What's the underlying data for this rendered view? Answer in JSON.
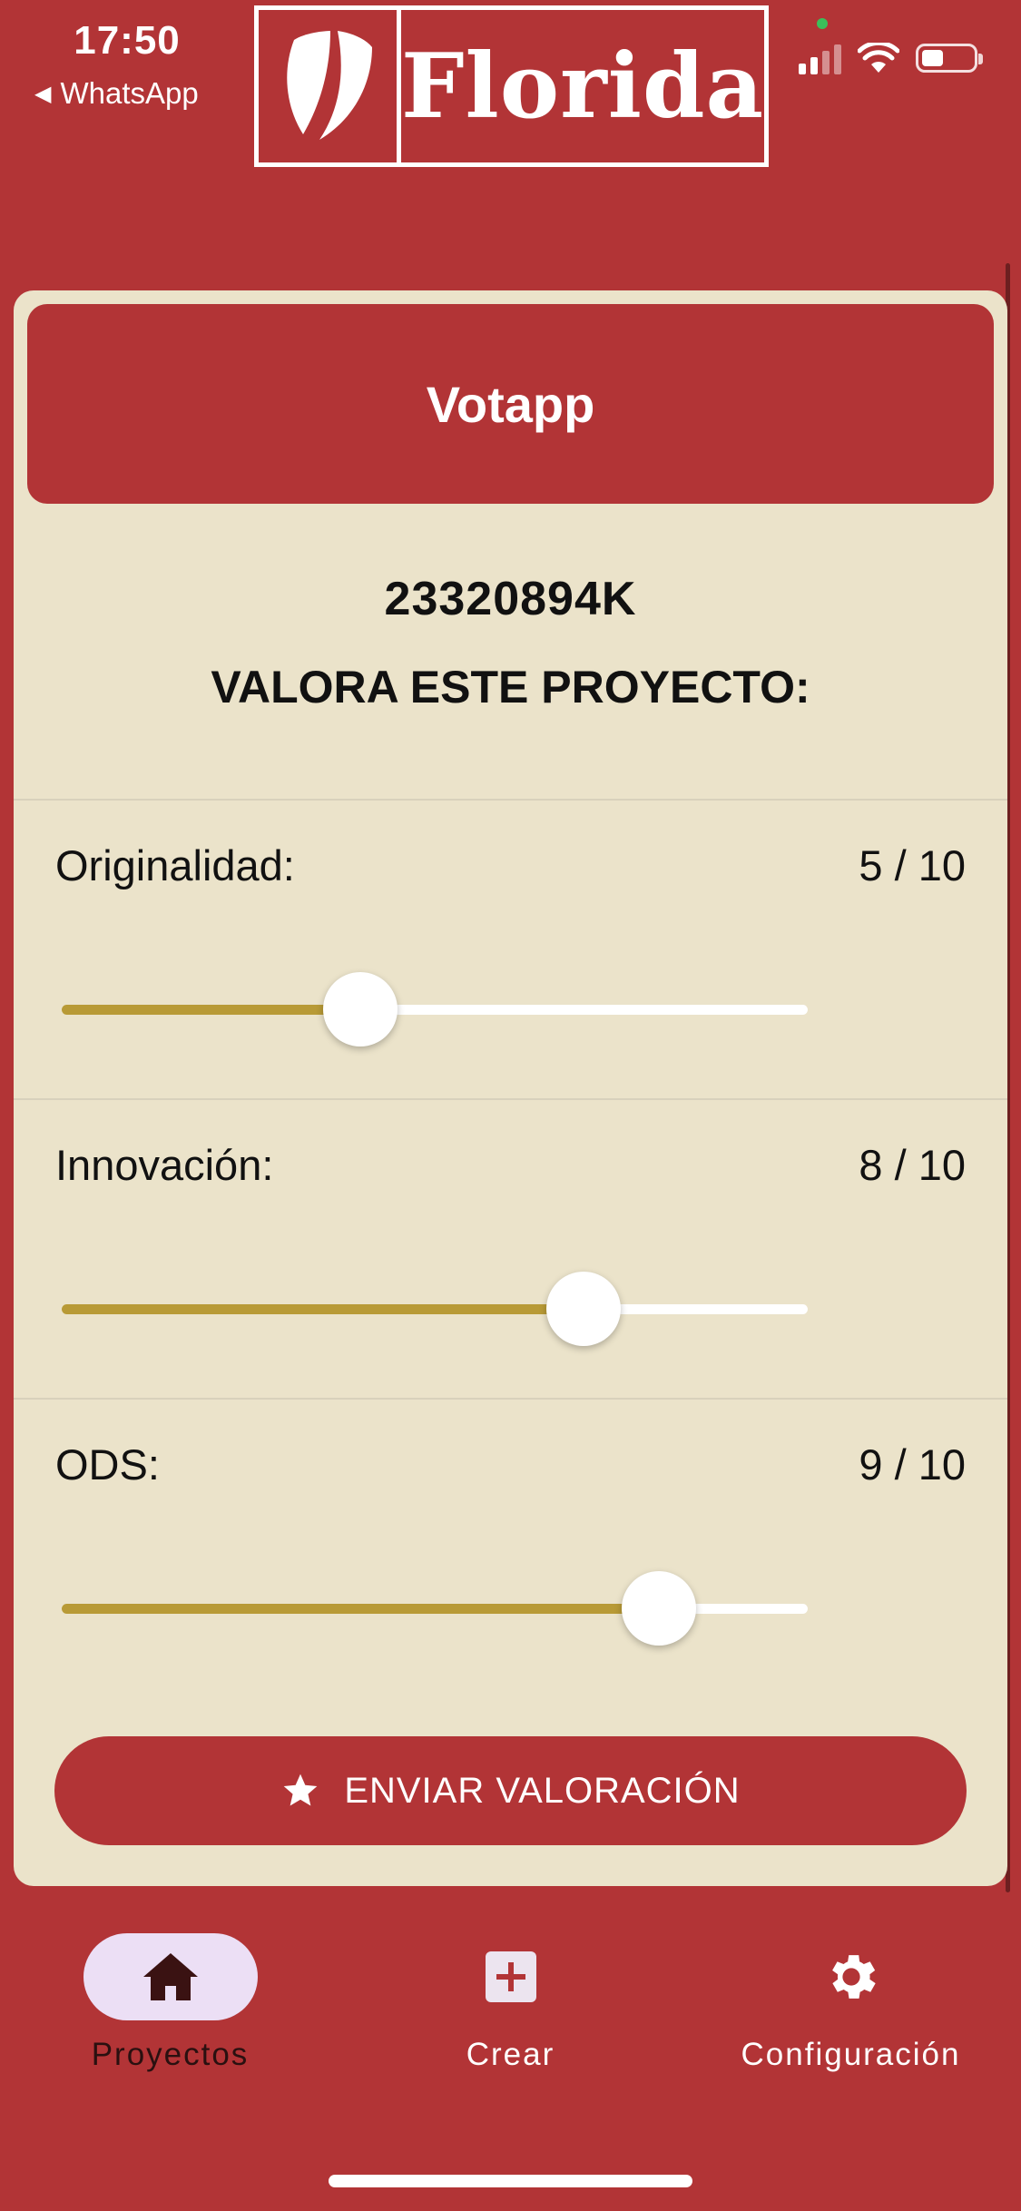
{
  "status_bar": {
    "time": "17:50",
    "back_app": "WhatsApp",
    "icons": [
      "signal-icon",
      "wifi-icon",
      "battery-icon"
    ]
  },
  "logo": {
    "text": "Florida",
    "icon": "shield-leaf-icon"
  },
  "header": {
    "title": "Votapp"
  },
  "project": {
    "id": "23320894K",
    "prompt": "VALORA ESTE PROYECTO:"
  },
  "criteria": [
    {
      "label": "Originalidad:",
      "score_text": "5 / 10",
      "value": 5,
      "max": 10
    },
    {
      "label": "Innovación:",
      "score_text": "8 / 10",
      "value": 8,
      "max": 10
    },
    {
      "label": "ODS:",
      "score_text": "9 / 10",
      "value": 9,
      "max": 10
    }
  ],
  "submit": {
    "label": "ENVIAR VALORACIÓN",
    "icon": "star-icon"
  },
  "nav": {
    "items": [
      {
        "label": "Proyectos",
        "icon": "home-icon",
        "active": true
      },
      {
        "label": "Crear",
        "icon": "add-box-icon",
        "active": false
      },
      {
        "label": "Configuración",
        "icon": "gear-icon",
        "active": false
      }
    ]
  },
  "colors": {
    "primary": "#b23436",
    "card": "#ebe3ca",
    "slider_active": "#b89a36",
    "nav_active_pill": "#ecdff5"
  }
}
